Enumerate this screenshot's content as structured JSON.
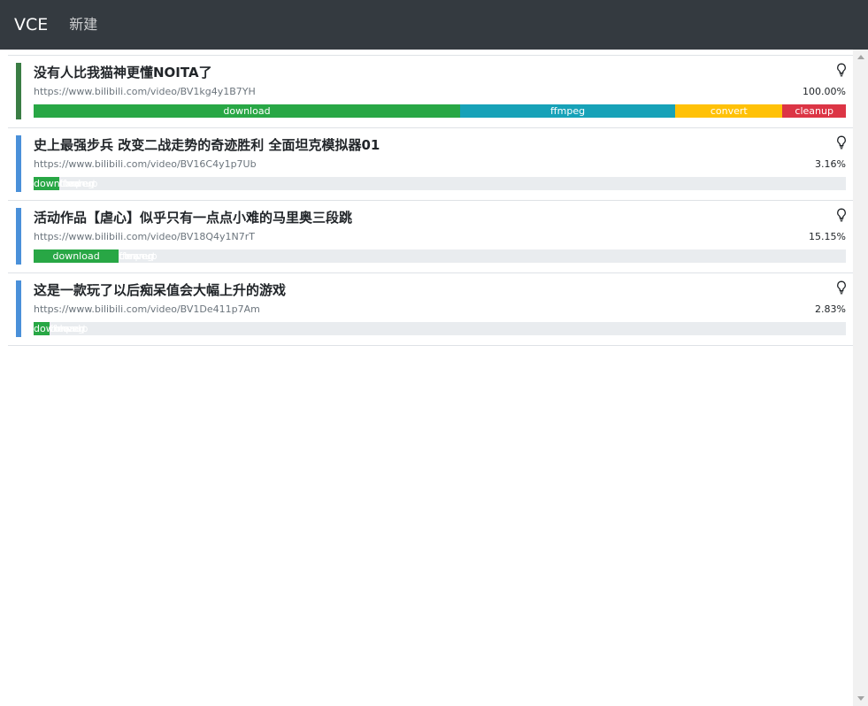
{
  "navbar": {
    "brand": "VCE",
    "new_label": "新建"
  },
  "tasks": [
    {
      "title": "没有人比我猫神更懂NOITA了",
      "url": "https://www.bilibili.com/video/BV1kg4y1B7YH",
      "percent_label": "100.00%",
      "accent_color": "#3a7d44",
      "stages": [
        {
          "label": "download",
          "fraction": 0.525
        },
        {
          "label": "ffmpeg",
          "fraction": 0.265
        },
        {
          "label": "convert",
          "fraction": 0.132
        },
        {
          "label": "cleanup",
          "fraction": 0.078
        }
      ]
    },
    {
      "title": "史上最强步兵 改变二战走势的奇迹胜利 全面坦克模拟器01",
      "url": "https://www.bilibili.com/video/BV16C4y1p7Ub",
      "percent_label": "3.16%",
      "accent_color": "#4a90d9",
      "stages": [
        {
          "label": "download",
          "fraction": 0.0316
        },
        {
          "label": "ffmpeg",
          "fraction": 0
        },
        {
          "label": "convert",
          "fraction": 0
        },
        {
          "label": "cleanup",
          "fraction": 0
        }
      ]
    },
    {
      "title": "活动作品【虐心】似乎只有一点点小难的马里奥三段跳",
      "url": "https://www.bilibili.com/video/BV18Q4y1N7rT",
      "percent_label": "15.15%",
      "accent_color": "#4a90d9",
      "stages": [
        {
          "label": "download",
          "fraction": 0.1048
        },
        {
          "label": "ffmpeg",
          "fraction": 0
        },
        {
          "label": "convert",
          "fraction": 0
        },
        {
          "label": "cleanup",
          "fraction": 0
        }
      ]
    },
    {
      "title": "这是一款玩了以后痴呆值会大幅上升的游戏",
      "url": "https://www.bilibili.com/video/BV1De411p7Am",
      "percent_label": "2.83%",
      "accent_color": "#4a90d9",
      "stages": [
        {
          "label": "download",
          "fraction": 0.0196
        },
        {
          "label": "ffmpeg",
          "fraction": 0
        },
        {
          "label": "convert",
          "fraction": 0
        },
        {
          "label": "cleanup",
          "fraction": 0
        }
      ]
    }
  ],
  "icons": {
    "task_action": "lightbulb-icon",
    "scroll_up": "scroll-up-arrow",
    "scroll_down": "scroll-down-arrow"
  }
}
